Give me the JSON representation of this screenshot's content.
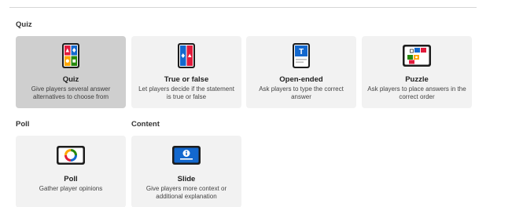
{
  "sections": {
    "quiz": {
      "title": "Quiz"
    },
    "poll": {
      "title": "Poll"
    },
    "content": {
      "title": "Content"
    }
  },
  "cards": {
    "quiz": {
      "name": "Quiz",
      "description": "Give players several answer alternatives to choose from",
      "icon": "quiz-icon",
      "selected": true
    },
    "true_false": {
      "name": "True or false",
      "description": "Let players decide if the statement is true or false",
      "icon": "true-false-icon"
    },
    "open_ended": {
      "name": "Open-ended",
      "description": "Ask players to type the correct answer",
      "icon": "open-ended-icon"
    },
    "puzzle": {
      "name": "Puzzle",
      "description": "Ask players to place answers in the correct order",
      "icon": "puzzle-icon"
    },
    "poll": {
      "name": "Poll",
      "description": "Gather player opinions",
      "icon": "poll-icon"
    },
    "slide": {
      "name": "Slide",
      "description": "Give players more context or additional explanation",
      "icon": "slide-icon"
    }
  },
  "colors": {
    "red": "#e21b3c",
    "blue": "#1368ce",
    "yellow": "#ffa602",
    "green": "#26890c",
    "selected_card": "#cfcfcf",
    "card": "#f2f2f2"
  }
}
